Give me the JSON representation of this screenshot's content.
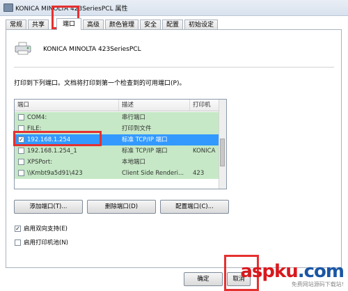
{
  "window": {
    "title": "KONICA MINOLTA 423SeriesPCL 属性"
  },
  "tabs": [
    {
      "label": "常规"
    },
    {
      "label": "共享"
    },
    {
      "label": "端口"
    },
    {
      "label": "高级"
    },
    {
      "label": "颜色管理"
    },
    {
      "label": "安全"
    },
    {
      "label": "配置"
    },
    {
      "label": "初始设定"
    }
  ],
  "printer": {
    "name": "KONICA MINOLTA 423SeriesPCL"
  },
  "instruction": "打印到下列端口。文档将打印到第一个检查到的可用端口(P)。",
  "port_list": {
    "headers": [
      "端口",
      "描述",
      "打印机"
    ],
    "rows": [
      {
        "port": "COM4:",
        "desc": "串行端口",
        "printer": ""
      },
      {
        "port": "FILE:",
        "desc": "打印到文件",
        "printer": ""
      },
      {
        "port": "192.168.1.254",
        "desc": "标准 TCP/IP 端口",
        "printer": "",
        "checked": true,
        "selected": true
      },
      {
        "port": "192.168.1.254_1",
        "desc": "标准 TCP/IP 端口",
        "printer": "KONICA"
      },
      {
        "port": "XPSPort:",
        "desc": "本地端口",
        "printer": ""
      },
      {
        "port": "\\\\Kmbt9a5d91\\423",
        "desc": "Client Side Renderi...",
        "printer": "423"
      }
    ]
  },
  "buttons": {
    "add_port": "添加端口(T)...",
    "delete_port": "删除端口(D)",
    "configure_port": "配置端口(C)...",
    "ok": "确定",
    "cancel": "取消"
  },
  "options": {
    "bidirectional": {
      "label": "启用双向支持(E)",
      "checked": true
    },
    "pooling": {
      "label": "启用打印机池(N)",
      "checked": false
    }
  },
  "watermark": {
    "logo": "aspku",
    "logo_suffix": ".com",
    "subtitle": "免费网站源码下载站!"
  },
  "colors": {
    "list_row_bg": "#c6e8c6",
    "selected_row_bg": "#3399ff",
    "annotation_red": "#e53030"
  }
}
